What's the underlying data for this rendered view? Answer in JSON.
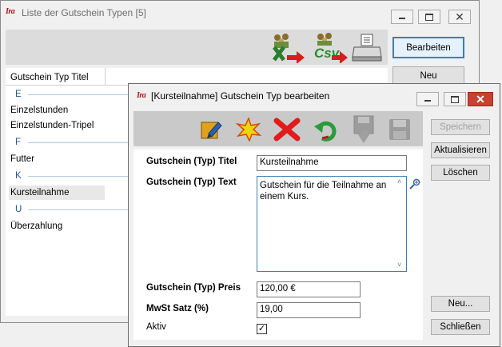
{
  "back_window": {
    "title": "Liste der Gutschein Typen [5]",
    "app_icon_text": "Ira",
    "column_header": "Gutschein Typ Titel",
    "buttons": {
      "edit": "Bearbeiten",
      "new": "Neu"
    },
    "toolbar_icons": [
      "excel-export-icon",
      "csv-export-icon",
      "print-icon"
    ],
    "csv_label": "Csv",
    "groups": [
      {
        "letter": "E",
        "items": [
          "Einzelstunden",
          "Einzelstunden-Tripel"
        ]
      },
      {
        "letter": "F",
        "items": [
          "Futter"
        ]
      },
      {
        "letter": "K",
        "items": [
          "Kursteilnahme"
        ]
      },
      {
        "letter": "U",
        "items": [
          "Überzahlung"
        ]
      }
    ]
  },
  "front_window": {
    "title": "[Kursteilnahme] Gutschein Typ bearbeiten",
    "app_icon_text": "Ira",
    "toolbar_icons": [
      "edit-icon",
      "new-star-icon",
      "delete-x-icon",
      "undo-arrow-icon",
      "save-download-icon",
      "save-icon"
    ],
    "form": {
      "title_label": "Gutschein (Typ) Titel",
      "title_value": "Kursteilnahme",
      "text_label": "Gutschein (Typ) Text",
      "text_value": "Gutschein für die Teilnahme an einem Kurs.",
      "price_label": "Gutschein (Typ) Preis",
      "price_value": "120,00 €",
      "vat_label": "MwSt Satz (%)",
      "vat_value": "19,00",
      "active_label": "Aktiv",
      "active_checked": "✓"
    },
    "side_buttons": {
      "save": "Speichern",
      "refresh": "Aktualisieren",
      "delete": "Löschen",
      "new": "Neu...",
      "close": "Schließen"
    }
  },
  "colors": {
    "accent": "#3c7fb1",
    "close_red": "#c84031",
    "group_blue": "#26568a"
  }
}
